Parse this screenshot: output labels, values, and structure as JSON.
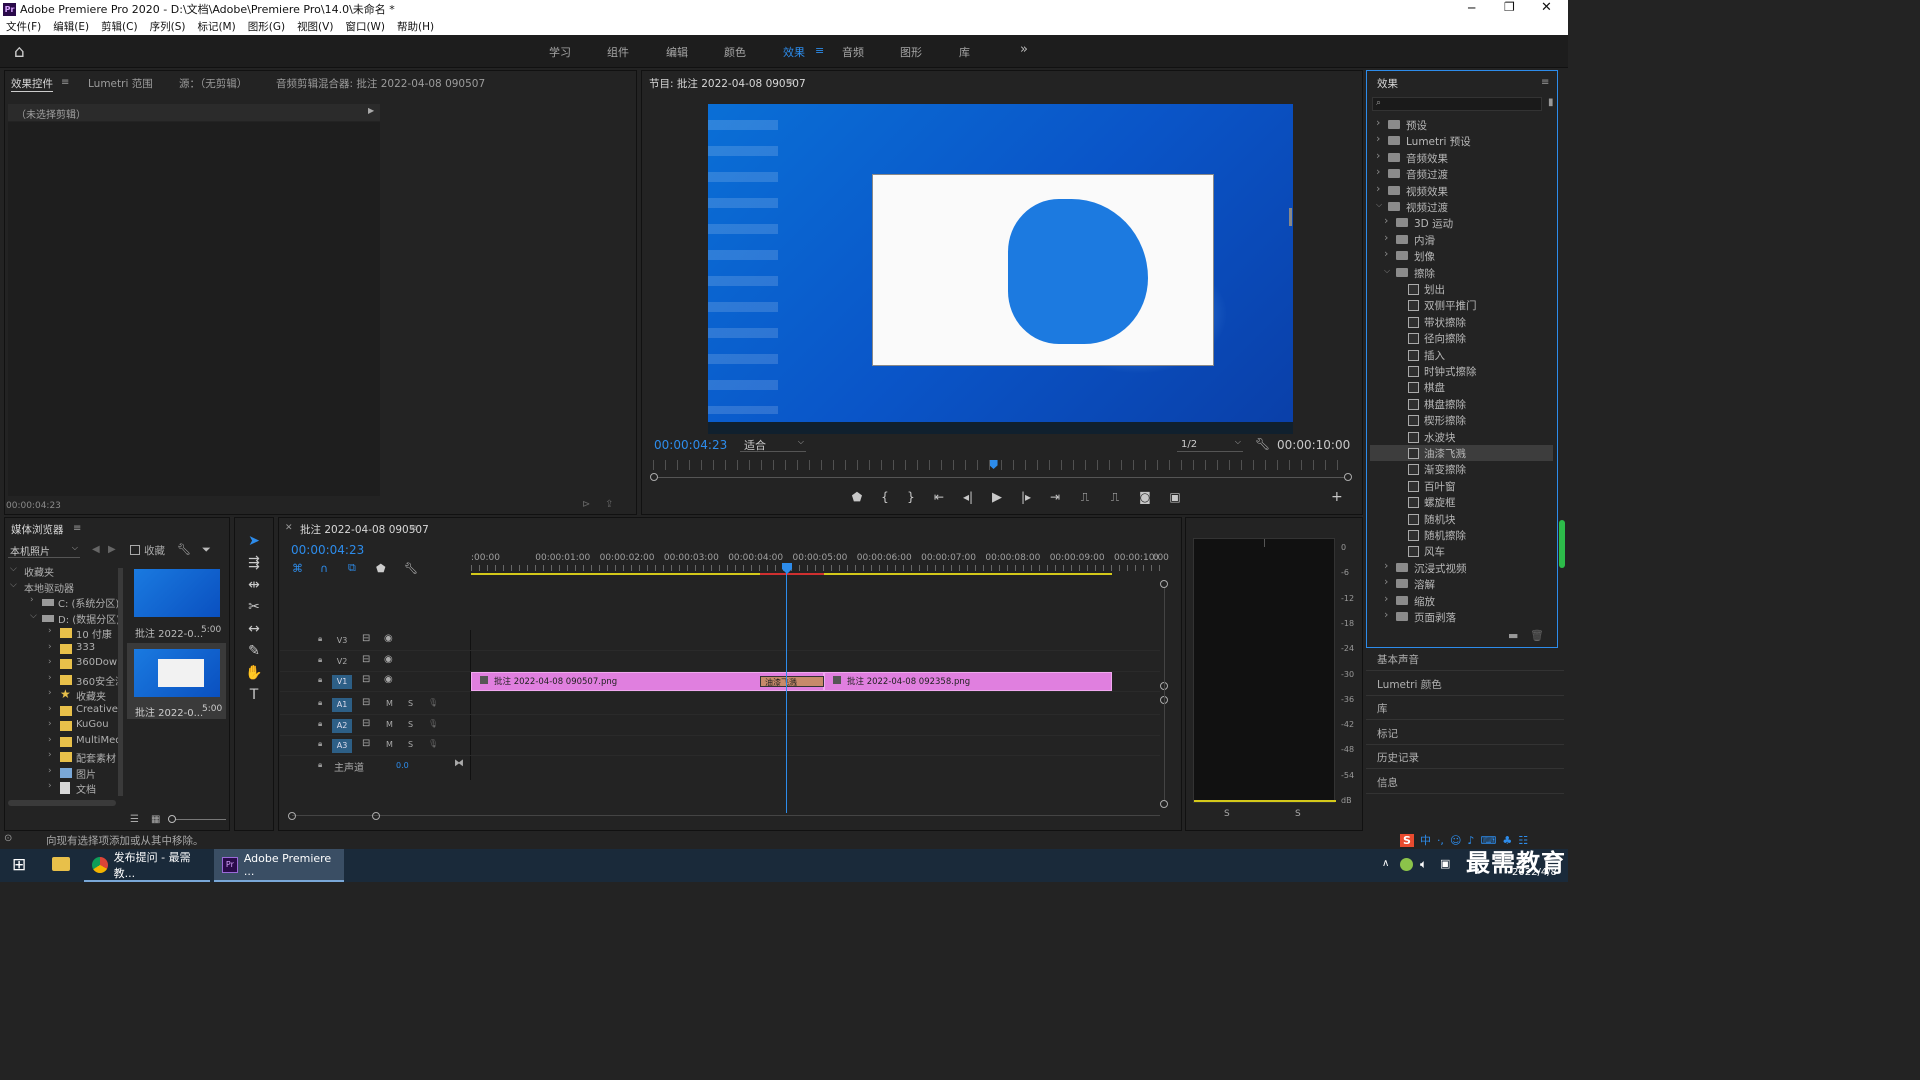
{
  "app": {
    "title": "Adobe Premiere Pro 2020 - D:\\文档\\Adobe\\Premiere Pro\\14.0\\未命名 *",
    "logo": "Pr"
  },
  "menu": [
    "文件(F)",
    "编辑(E)",
    "剪辑(C)",
    "序列(S)",
    "标记(M)",
    "图形(G)",
    "视图(V)",
    "窗口(W)",
    "帮助(H)"
  ],
  "workspaces": [
    {
      "label": "学习"
    },
    {
      "label": "组件"
    },
    {
      "label": "编辑"
    },
    {
      "label": "颜色"
    },
    {
      "label": "效果",
      "active": true
    },
    {
      "label": "音频"
    },
    {
      "label": "图形"
    },
    {
      "label": "库"
    }
  ],
  "source_panel": {
    "tabs": [
      "效果控件",
      "Lumetri 范围",
      "源：（无剪辑）",
      "音频剪辑混合器: 批注 2022-04-08 090507"
    ],
    "no_clip": "（未选择剪辑）",
    "timecode": "00:00:04:23"
  },
  "program": {
    "title": "节目: 批注 2022-04-08 090507",
    "timecode": "00:00:04:23",
    "fit": "适合",
    "quality": "1/2",
    "duration": "00:00:10:00",
    "playhead_fraction": 0.49
  },
  "media_browser": {
    "title": "媒体浏览器",
    "location": "本机照片",
    "favorites_label": "收藏",
    "tree": [
      {
        "label": "收藏夹",
        "level": 0
      },
      {
        "label": "本地驱动器",
        "level": 0
      },
      {
        "label": "C: (系统分区)",
        "level": 1
      },
      {
        "label": "D: (数据分区)",
        "level": 1
      },
      {
        "label": "10 付康",
        "level": 2
      },
      {
        "label": "333",
        "level": 2
      },
      {
        "label": "360Downloads",
        "level": 2
      },
      {
        "label": "360安全浏览器",
        "level": 2
      },
      {
        "label": "收藏夹",
        "level": 2
      },
      {
        "label": "Creative",
        "level": 2
      },
      {
        "label": "KuGou",
        "level": 2
      },
      {
        "label": "MultiMedia",
        "level": 2
      },
      {
        "label": "配套素材",
        "level": 2
      },
      {
        "label": "图片",
        "level": 2
      },
      {
        "label": "文档",
        "level": 2
      }
    ],
    "thumbs": [
      {
        "name": "批注 2022-0...",
        "dur": "5:00"
      },
      {
        "name": "批注 2022-0...",
        "dur": "5:00"
      }
    ],
    "status": "向现有选择项添加或从其中移除。"
  },
  "timeline": {
    "title": "批注 2022-04-08 090507",
    "timecode": "00:00:04:23",
    "ruler": [
      ":00:00",
      "00:00:01:00",
      "00:00:02:00",
      "00:00:03:00",
      "00:00:04:00",
      "00:00:05:00",
      "00:00:06:00",
      "00:00:07:00",
      "00:00:08:00",
      "00:00:09:00",
      "00:00:10:00",
      "0"
    ],
    "video_tracks": [
      "V3",
      "V2",
      "V1"
    ],
    "audio_tracks": [
      "A1",
      "A2",
      "A3"
    ],
    "master": "主声道",
    "master_val": "0.0",
    "clip1": "批注 2022-04-08 090507.png",
    "clip2": "批注 2022-04-08 092358.png",
    "transition": "油漆飞溅",
    "m": "M",
    "s": "S"
  },
  "effects": {
    "title": "效果",
    "items": [
      {
        "label": "预设",
        "level": 0,
        "type": "folder",
        "open": false
      },
      {
        "label": "Lumetri 预设",
        "level": 0,
        "type": "folder",
        "open": false
      },
      {
        "label": "音频效果",
        "level": 0,
        "type": "folder",
        "open": false
      },
      {
        "label": "音频过渡",
        "level": 0,
        "type": "folder",
        "open": false
      },
      {
        "label": "视频效果",
        "level": 0,
        "type": "folder",
        "open": false
      },
      {
        "label": "视频过渡",
        "level": 0,
        "type": "folder",
        "open": true
      },
      {
        "label": "3D 运动",
        "level": 1,
        "type": "folder",
        "open": false
      },
      {
        "label": "内滑",
        "level": 1,
        "type": "folder",
        "open": false
      },
      {
        "label": "划像",
        "level": 1,
        "type": "folder",
        "open": false
      },
      {
        "label": "擦除",
        "level": 1,
        "type": "folder",
        "open": true
      },
      {
        "label": "划出",
        "level": 2,
        "type": "preset"
      },
      {
        "label": "双侧平推门",
        "level": 2,
        "type": "preset"
      },
      {
        "label": "带状擦除",
        "level": 2,
        "type": "preset"
      },
      {
        "label": "径向擦除",
        "level": 2,
        "type": "preset"
      },
      {
        "label": "插入",
        "level": 2,
        "type": "preset"
      },
      {
        "label": "时钟式擦除",
        "level": 2,
        "type": "preset"
      },
      {
        "label": "棋盘",
        "level": 2,
        "type": "preset"
      },
      {
        "label": "棋盘擦除",
        "level": 2,
        "type": "preset"
      },
      {
        "label": "楔形擦除",
        "level": 2,
        "type": "preset"
      },
      {
        "label": "水波块",
        "level": 2,
        "type": "preset"
      },
      {
        "label": "油漆飞溅",
        "level": 2,
        "type": "preset",
        "selected": true
      },
      {
        "label": "渐变擦除",
        "level": 2,
        "type": "preset"
      },
      {
        "label": "百叶窗",
        "level": 2,
        "type": "preset"
      },
      {
        "label": "螺旋框",
        "level": 2,
        "type": "preset"
      },
      {
        "label": "随机块",
        "level": 2,
        "type": "preset"
      },
      {
        "label": "随机擦除",
        "level": 2,
        "type": "preset"
      },
      {
        "label": "风车",
        "level": 2,
        "type": "preset"
      },
      {
        "label": "沉浸式视频",
        "level": 1,
        "type": "folder",
        "open": false
      },
      {
        "label": "溶解",
        "level": 1,
        "type": "folder",
        "open": false
      },
      {
        "label": "缩放",
        "level": 1,
        "type": "folder",
        "open": false
      },
      {
        "label": "页面剥落",
        "level": 1,
        "type": "folder",
        "open": false
      }
    ]
  },
  "right_panels": [
    "基本声音",
    "Lumetri 颜色",
    "库",
    "标记",
    "历史记录",
    "信息"
  ],
  "meter_scale": [
    "0",
    "-6",
    "-12",
    "-18",
    "-24",
    "-30",
    "-36",
    "-42",
    "-48",
    "-54",
    "dB"
  ],
  "meter_solo": [
    "S",
    "S"
  ],
  "taskbar": {
    "items": [
      "发布提问 - 最需教...",
      "Adobe Premiere ..."
    ],
    "date": "2022/4/8",
    "watermark": "最需教育",
    "ime": "中"
  },
  "colors": {
    "accent": "#2d8ceb",
    "clip": "#e07fdf",
    "transition": "#c78a6a",
    "yellow": "#d4c91a"
  }
}
